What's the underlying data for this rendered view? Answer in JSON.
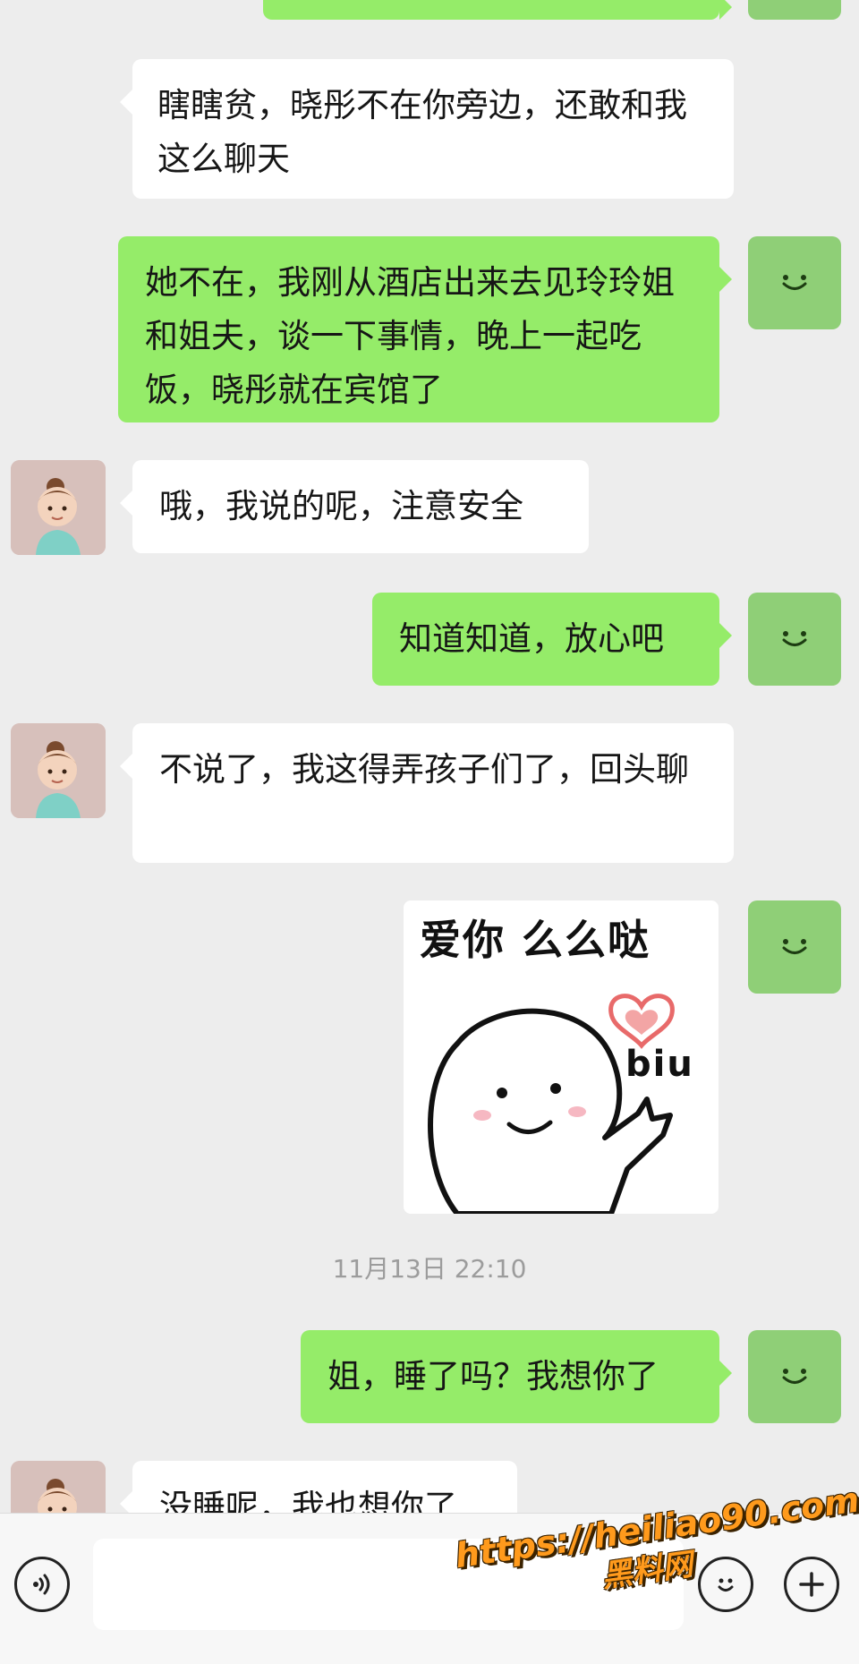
{
  "messages": [
    {
      "side": "out",
      "text": ""
    },
    {
      "side": "in",
      "text": "瞎瞎贫，晓彤不在你旁边，还敢和我这么聊天"
    },
    {
      "side": "out",
      "text": "她不在，我刚从酒店出来去见玲玲姐和姐夫，谈一下事情，晚上一起吃饭，晓彤就在宾馆了"
    },
    {
      "side": "in",
      "text": "哦，我说的呢，注意安全"
    },
    {
      "side": "out",
      "text": "知道知道，放心吧"
    },
    {
      "side": "in",
      "text": "不说了，我这得弄孩子们了，回头聊"
    },
    {
      "side": "out",
      "type": "sticker",
      "sticker_title": "爱你 么么哒",
      "sticker_caption": "biu"
    },
    {
      "side": "out",
      "text": "姐，睡了吗？我想你了"
    },
    {
      "side": "in",
      "text": "没睡呢，我也想你了"
    }
  ],
  "timestamp": "11月13日 22:10",
  "input_bar": {
    "voice_icon": "voice-icon",
    "emoji_icon": "emoji-icon",
    "plus_icon": "plus-icon"
  },
  "watermark": {
    "url": "https://heiliao90.com",
    "name": "黑料网"
  },
  "colors": {
    "background": "#ededed",
    "outgoing_bubble": "#95ec69",
    "incoming_bubble": "#ffffff",
    "my_avatar": "#8fcf77"
  }
}
